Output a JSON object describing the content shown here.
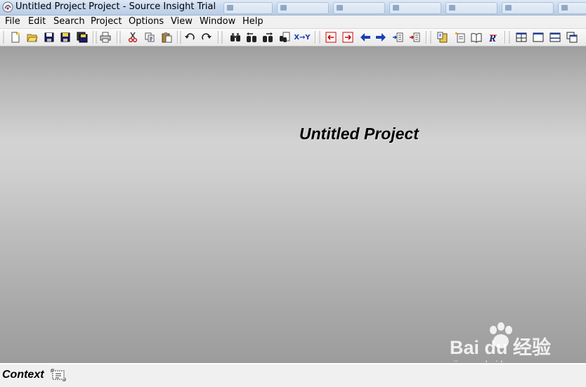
{
  "window": {
    "title": "Untitled Project Project - Source Insight Trial",
    "icon": "source-insight-app-icon"
  },
  "menu": {
    "items": [
      "File",
      "Edit",
      "Search",
      "Project",
      "Options",
      "View",
      "Window",
      "Help"
    ]
  },
  "toolbar": {
    "buttons": [
      "new-file",
      "open-file",
      "save",
      "save-as",
      "save-all",
      "print",
      "cut",
      "copy",
      "paste",
      "undo",
      "redo",
      "search",
      "search-backward",
      "search-forward",
      "search-files",
      "replace",
      "jump-previous-bookmark",
      "jump-next-bookmark",
      "go-back",
      "go-forward",
      "jump-to-caller",
      "jump-to-definition",
      "project-window",
      "symbol-window",
      "browse-project",
      "relation-window",
      "tile-horizontal",
      "tile-one",
      "tile-vertical",
      "cascade"
    ],
    "replace_label": "X→Y"
  },
  "workspace": {
    "project_title": "Untitled Project"
  },
  "context_bar": {
    "label": "Context",
    "icon": "context-window-icon"
  },
  "watermark": {
    "logo": "Bai du 经验",
    "url": "jingyan.baidu.com"
  },
  "colors": {
    "accent_red": "#cc0000",
    "accent_blue": "#1a3fb5",
    "folder_yellow": "#e8c84a"
  }
}
